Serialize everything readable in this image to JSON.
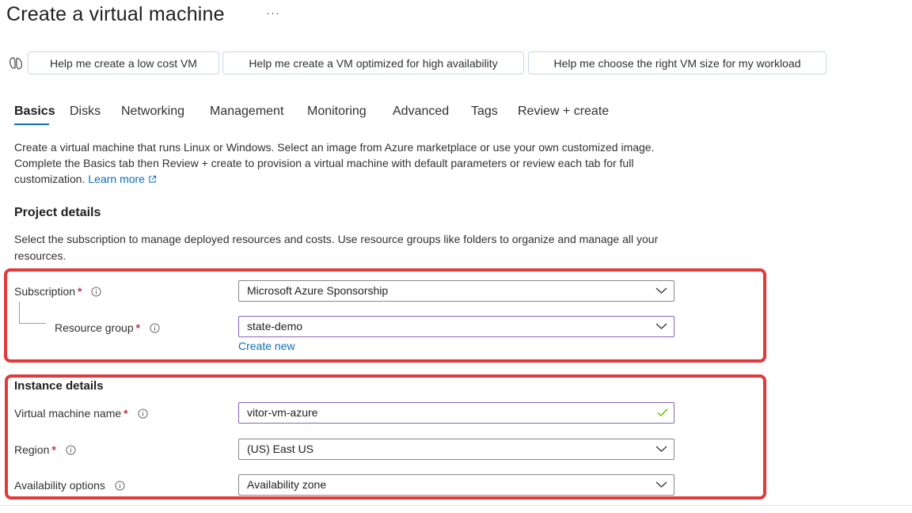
{
  "page": {
    "title": "Create a virtual machine",
    "more": "···"
  },
  "copilot": {
    "icon": "copilot-icon",
    "suggestions": [
      "Help me create a low cost VM",
      "Help me create a VM optimized for high availability",
      "Help me choose the right VM size for my workload"
    ]
  },
  "tabs": [
    {
      "label": "Basics",
      "active": true
    },
    {
      "label": "Disks"
    },
    {
      "label": "Networking"
    },
    {
      "label": "Management"
    },
    {
      "label": "Monitoring"
    },
    {
      "label": "Advanced"
    },
    {
      "label": "Tags"
    },
    {
      "label": "Review + create"
    }
  ],
  "intro": {
    "text": "Create a virtual machine that runs Linux or Windows. Select an image from Azure marketplace or use your own customized image. Complete the Basics tab then Review + create to provision a virtual machine with default parameters or review each tab for full customization.",
    "link": "Learn more"
  },
  "project": {
    "title": "Project details",
    "description": "Select the subscription to manage deployed resources and costs. Use resource groups like folders to organize and manage all your resources.",
    "subscription": {
      "label": "Subscription",
      "required": "*",
      "value": "Microsoft Azure Sponsorship"
    },
    "resource_group": {
      "label": "Resource group",
      "required": "*",
      "value": "state-demo",
      "create_new": "Create new"
    }
  },
  "instance": {
    "title": "Instance details",
    "vm_name": {
      "label": "Virtual machine name",
      "required": "*",
      "value": "vitor-vm-azure"
    },
    "region": {
      "label": "Region",
      "required": "*",
      "value": "(US) East US"
    },
    "availability": {
      "label": "Availability options",
      "value": "Availability zone"
    }
  },
  "colors": {
    "accent": "#0f6cbd",
    "highlight": "#e03b3b",
    "required": "#c4314b",
    "valid": "#6bb700"
  }
}
